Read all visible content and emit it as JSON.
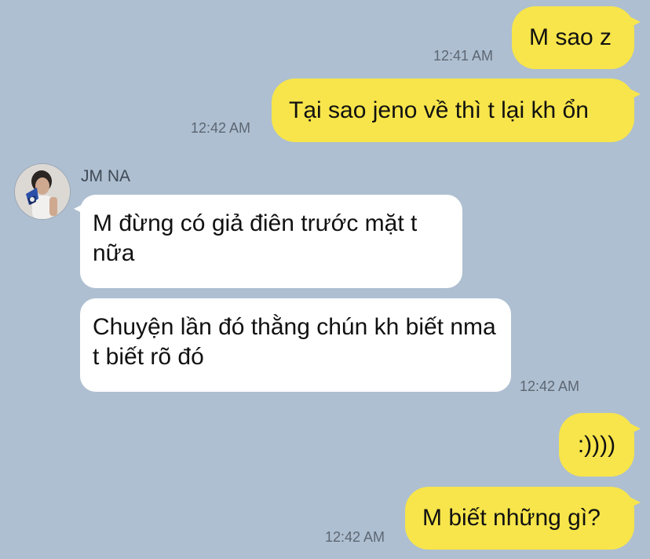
{
  "chat": {
    "contact_name": "JM NA",
    "messages": [
      {
        "sender": "me",
        "text": "M sao z",
        "time": "12:41 AM"
      },
      {
        "sender": "me",
        "text": "Tại sao jeno về thì t lại kh ổn",
        "time": "12:42 AM"
      },
      {
        "sender": "them",
        "text": "M đừng có giả điên trước mặt t nữa",
        "time": ""
      },
      {
        "sender": "them",
        "text": "Chuyện lần đó thằng chún kh biết nma t biết rõ đó",
        "time": "12:42 AM"
      },
      {
        "sender": "me",
        "text": ":))))",
        "time": ""
      },
      {
        "sender": "me",
        "text": "M biết những gì?",
        "time": "12:42 AM"
      }
    ]
  },
  "colors": {
    "background": "#aebfd1",
    "outgoing_bubble": "#f7e54b",
    "incoming_bubble": "#ffffff",
    "timestamp_text": "#5d6773"
  },
  "icons": {
    "avatar": "contact-avatar"
  }
}
